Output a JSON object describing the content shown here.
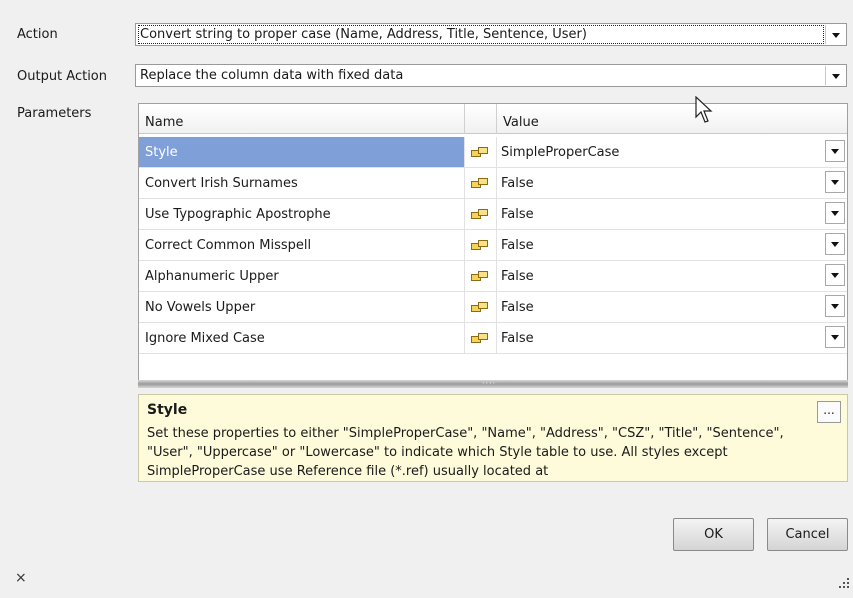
{
  "labels": {
    "action": "Action",
    "output_action": "Output Action",
    "parameters": "Parameters"
  },
  "action_combo": {
    "value": "Convert string to proper case (Name, Address, Title, Sentence, User)"
  },
  "output_combo": {
    "value": "Replace the column data with fixed data"
  },
  "grid": {
    "headers": {
      "name": "Name",
      "value": "Value"
    },
    "rows": [
      {
        "name": "Style",
        "value": "SimpleProperCase",
        "selected": true
      },
      {
        "name": "Convert Irish Surnames",
        "value": "False"
      },
      {
        "name": "Use Typographic Apostrophe",
        "value": "False"
      },
      {
        "name": "Correct Common Misspell",
        "value": "False"
      },
      {
        "name": "Alphanumeric Upper",
        "value": "False"
      },
      {
        "name": "No Vowels Upper",
        "value": "False"
      },
      {
        "name": "Ignore Mixed Case",
        "value": "False"
      }
    ]
  },
  "help": {
    "title": "Style",
    "body": "Set these properties to either \"SimpleProperCase\", \"Name\", \"Address\", \"CSZ\", \"Title\", \"Sentence\", \"User\", \"Uppercase\" or \"Lowercase\" to indicate which Style table to use. All styles except SimpleProperCase use Reference file (*.ref) usually located at",
    "more_label": "..."
  },
  "buttons": {
    "ok": "OK",
    "cancel": "Cancel"
  },
  "footer": {
    "close": "×"
  },
  "colors": {
    "selection": "#7f9fd9",
    "help_bg": "#fdfbda"
  },
  "icons": [
    "dropdown-arrow-icon",
    "parameter-icon",
    "close-icon",
    "resize-grip-icon"
  ]
}
